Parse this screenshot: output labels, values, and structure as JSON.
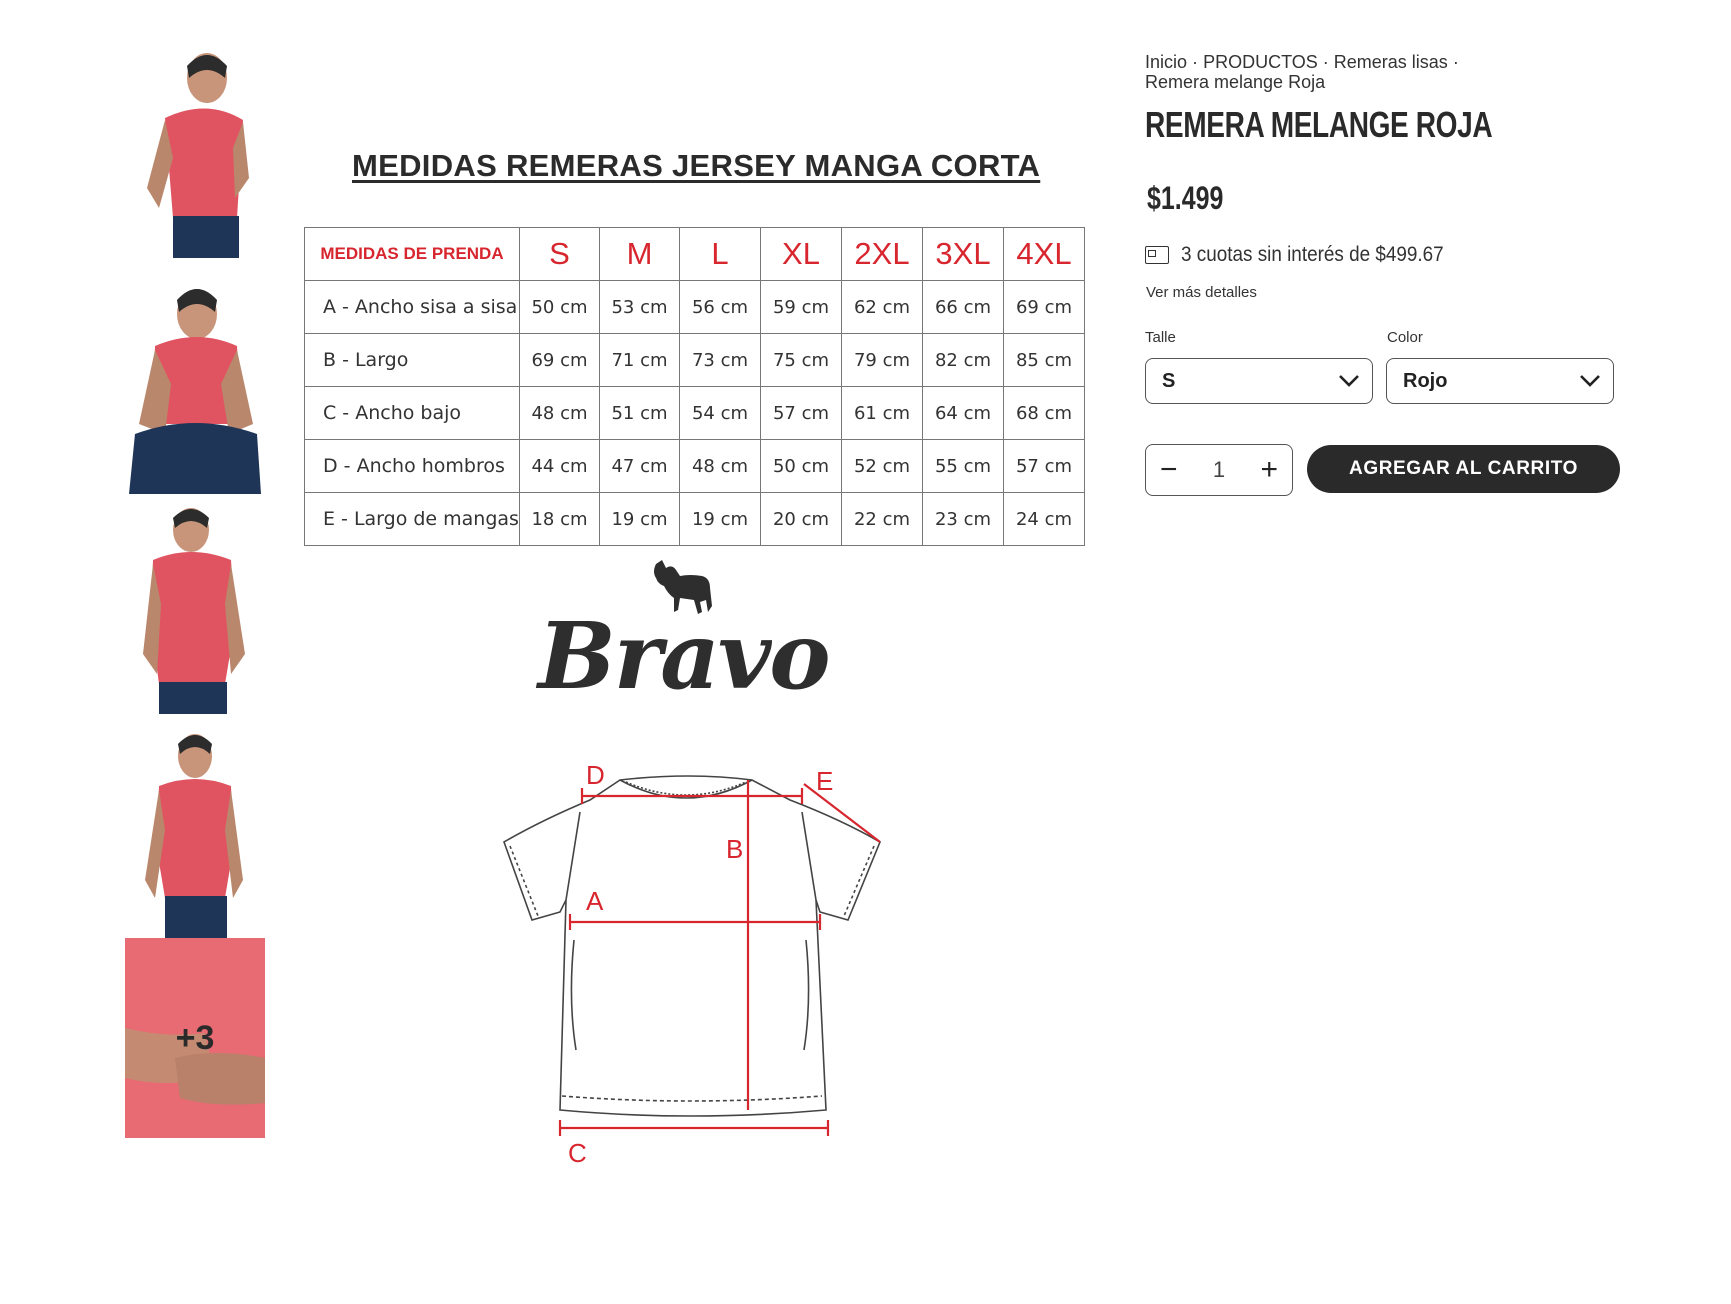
{
  "thumbnails": {
    "more_badge": "+3",
    "shirt_color": "#e05461",
    "skin_color": "#c8957a",
    "jeans_color": "#1f3557"
  },
  "size_chart": {
    "title": "MEDIDAS REMERAS JERSEY MANGA CORTA",
    "header_label": "MEDIDAS DE PRENDA",
    "sizes": [
      "S",
      "M",
      "L",
      "XL",
      "2XL",
      "3XL",
      "4XL"
    ],
    "rows": [
      {
        "label": "A - Ancho sisa a sisa",
        "values": [
          "50 cm",
          "53 cm",
          "56 cm",
          "59 cm",
          "62 cm",
          "66 cm",
          "69 cm"
        ]
      },
      {
        "label": "B - Largo",
        "values": [
          "69 cm",
          "71 cm",
          "73 cm",
          "75 cm",
          "79 cm",
          "82 cm",
          "85 cm"
        ]
      },
      {
        "label": "C - Ancho bajo",
        "values": [
          "48 cm",
          "51 cm",
          "54 cm",
          "57 cm",
          "61 cm",
          "64 cm",
          "68 cm"
        ]
      },
      {
        "label": "D - Ancho hombros",
        "values": [
          "44 cm",
          "47 cm",
          "48 cm",
          "50 cm",
          "52 cm",
          "55 cm",
          "57 cm"
        ]
      },
      {
        "label": "E - Largo de mangas",
        "values": [
          "18 cm",
          "19 cm",
          "19 cm",
          "20 cm",
          "22 cm",
          "23 cm",
          "24 cm"
        ]
      }
    ],
    "accent_color": "#d8262f"
  },
  "brand": {
    "name": "Bravo"
  },
  "diagram": {
    "labels": {
      "a": "A",
      "b": "B",
      "c": "C",
      "d": "D",
      "e": "E"
    }
  },
  "breadcrumb": {
    "items": [
      "Inicio",
      "PRODUCTOS",
      "Remeras lisas",
      "Remera melange Roja"
    ],
    "separator": "·"
  },
  "product": {
    "title": "REMERA MELANGE ROJA",
    "price": "$1.499",
    "installments": "3 cuotas sin interés de $499.67",
    "more_details": "Ver más detalles"
  },
  "variants": {
    "size_label": "Talle",
    "size_value": "S",
    "color_label": "Color",
    "color_value": "Rojo"
  },
  "cart": {
    "quantity": "1",
    "minus": "−",
    "plus": "+",
    "add_label": "AGREGAR AL CARRITO"
  }
}
